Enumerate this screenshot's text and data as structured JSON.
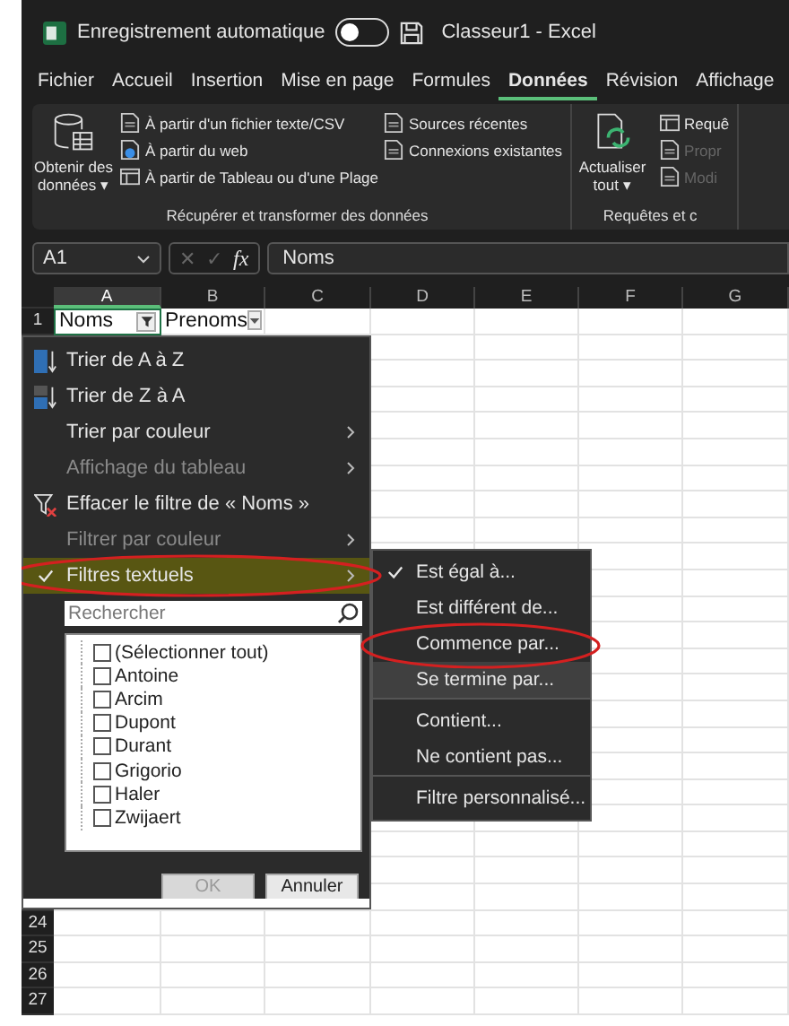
{
  "window": {
    "autosave_label": "Enregistrement automatique",
    "autosave_on": false,
    "title": "Classeur1  -  Excel"
  },
  "tabs": [
    {
      "label": "Fichier",
      "selected": false
    },
    {
      "label": "Accueil",
      "selected": false
    },
    {
      "label": "Insertion",
      "selected": false
    },
    {
      "label": "Mise en page",
      "selected": false
    },
    {
      "label": "Formules",
      "selected": false
    },
    {
      "label": "Données",
      "selected": true
    },
    {
      "label": "Révision",
      "selected": false
    },
    {
      "label": "Affichage",
      "selected": false
    }
  ],
  "ribbon": {
    "groups": [
      {
        "label": "Récupérer et transformer des données",
        "big": {
          "label": "Obtenir des données",
          "caret": "▾",
          "kind": "database"
        },
        "columns": [
          [
            {
              "label": "À partir d'un fichier texte/CSV",
              "kind": "file",
              "disabled": false
            },
            {
              "label": "À partir du web",
              "kind": "web",
              "disabled": false
            },
            {
              "label": "À partir de Tableau ou d'une Plage",
              "kind": "table",
              "disabled": false
            }
          ],
          [
            {
              "label": "Sources récentes",
              "kind": "file",
              "disabled": false
            },
            {
              "label": "Connexions existantes",
              "kind": "file",
              "disabled": false
            }
          ]
        ]
      },
      {
        "label": "Requêtes et c",
        "big": {
          "label": "Actualiser tout",
          "caret": "▾",
          "kind": "refresh"
        },
        "columns": [
          [
            {
              "label": "Requê",
              "kind": "table",
              "disabled": false
            },
            {
              "label": "Propr",
              "kind": "file",
              "disabled": true
            },
            {
              "label": "Modi",
              "kind": "file",
              "disabled": true
            }
          ]
        ]
      }
    ]
  },
  "formula_bar": {
    "name_box": "A1",
    "cancel": "✕",
    "enter": "✓",
    "fx": "fx",
    "value": "Noms"
  },
  "grid": {
    "columns": [
      {
        "label": "A",
        "selected": true
      },
      {
        "label": "B",
        "selected": false
      },
      {
        "label": "C",
        "selected": false
      },
      {
        "label": "D",
        "selected": false
      },
      {
        "label": "E",
        "selected": false
      },
      {
        "label": "F",
        "selected": false
      },
      {
        "label": "G",
        "selected": false
      }
    ],
    "header_row": {
      "number": "1",
      "cells": [
        "Noms",
        "Prenoms"
      ]
    },
    "lower_row_numbers": [
      "24",
      "25",
      "26",
      "27"
    ]
  },
  "filter_menu": {
    "items": [
      {
        "label": "Trier de A à Z",
        "kind": "sort-asc",
        "disabled": false,
        "submenu": false,
        "checked": false,
        "highlighted": false
      },
      {
        "label": "Trier de Z à A",
        "kind": "sort-desc",
        "disabled": false,
        "submenu": false,
        "checked": false,
        "highlighted": false
      },
      {
        "label": "Trier par couleur",
        "disabled": false,
        "submenu": true,
        "checked": false,
        "highlighted": false
      },
      {
        "label": "Affichage du tableau",
        "disabled": true,
        "submenu": true,
        "checked": false,
        "highlighted": false
      },
      {
        "label": "Effacer le filtre de « Noms »",
        "kind": "clear-filter",
        "disabled": false,
        "submenu": false,
        "checked": false,
        "highlighted": false
      },
      {
        "label": "Filtrer par couleur",
        "disabled": true,
        "submenu": true,
        "checked": false,
        "highlighted": false
      },
      {
        "label": "Filtres textuels",
        "disabled": false,
        "submenu": true,
        "checked": true,
        "highlighted": true
      }
    ],
    "search": {
      "placeholder": "Rechercher"
    },
    "values": [
      {
        "label": "(Sélectionner tout)",
        "checked": false
      },
      {
        "label": "Antoine",
        "checked": false
      },
      {
        "label": "Arcim",
        "checked": false
      },
      {
        "label": "Dupont",
        "checked": false
      },
      {
        "label": "Durant",
        "checked": false
      },
      {
        "label": "Grigorio",
        "checked": false
      },
      {
        "label": "Haler",
        "checked": false
      },
      {
        "label": "Zwijaert",
        "checked": false
      }
    ],
    "buttons": [
      {
        "label": "OK",
        "disabled": true
      },
      {
        "label": "Annuler",
        "disabled": false
      }
    ]
  },
  "text_filters_menu": {
    "items": [
      {
        "label": "Est égal à...",
        "checked": true,
        "highlighted": false,
        "separator": false
      },
      {
        "label": "Est différent de...",
        "checked": false,
        "highlighted": false,
        "separator": false
      },
      {
        "label": "Commence par...",
        "checked": false,
        "highlighted": false,
        "separator": false
      },
      {
        "label": "Se termine par...",
        "checked": false,
        "highlighted": true,
        "separator": true
      },
      {
        "label": "Contient...",
        "checked": false,
        "highlighted": false,
        "separator": false
      },
      {
        "label": "Ne contient pas...",
        "checked": false,
        "highlighted": false,
        "separator": true
      },
      {
        "label": "Filtre personnalisé...",
        "checked": false,
        "highlighted": false,
        "separator": false
      }
    ]
  }
}
